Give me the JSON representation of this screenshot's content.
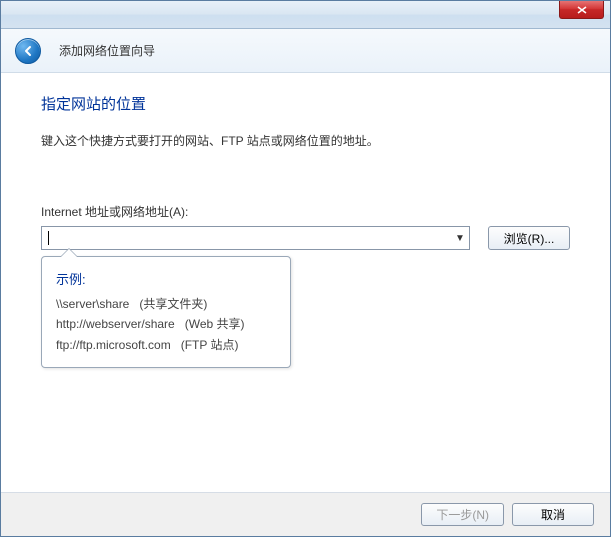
{
  "header": {
    "wizard_title": "添加网络位置向导"
  },
  "page": {
    "heading": "指定网站的位置",
    "instruction": "键入这个快捷方式要打开的网站、FTP 站点或网络位置的地址。"
  },
  "field": {
    "label": "Internet 地址或网络地址(A):",
    "value": "",
    "browse_label": "浏览(R)..."
  },
  "tooltip": {
    "title": "示例:",
    "examples": [
      {
        "addr": "\\\\server\\share",
        "desc": "(共享文件夹)"
      },
      {
        "addr": "http://webserver/share",
        "desc": "(Web 共享)"
      },
      {
        "addr": "ftp://ftp.microsoft.com",
        "desc": "(FTP 站点)"
      }
    ]
  },
  "footer": {
    "next_label": "下一步(N)",
    "cancel_label": "取消"
  }
}
